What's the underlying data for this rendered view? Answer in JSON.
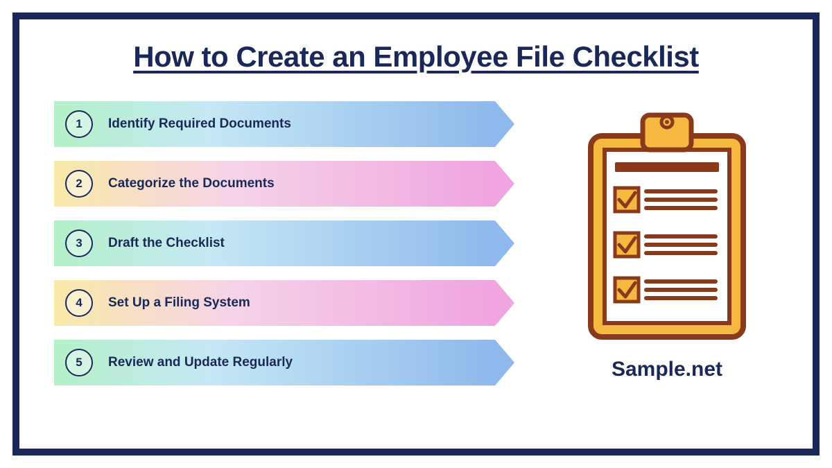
{
  "title": "How to Create an Employee File Checklist",
  "steps": [
    {
      "num": "1",
      "label": "Identify Required Documents",
      "variant": "green-blue"
    },
    {
      "num": "2",
      "label": "Categorize the Documents",
      "variant": "yellow-pink"
    },
    {
      "num": "3",
      "label": "Draft the Checklist",
      "variant": "green-blue"
    },
    {
      "num": "4",
      "label": "Set Up a Filing System",
      "variant": "yellow-pink"
    },
    {
      "num": "5",
      "label": "Review and Update Regularly",
      "variant": "green-blue"
    }
  ],
  "brand": "Sample.net"
}
